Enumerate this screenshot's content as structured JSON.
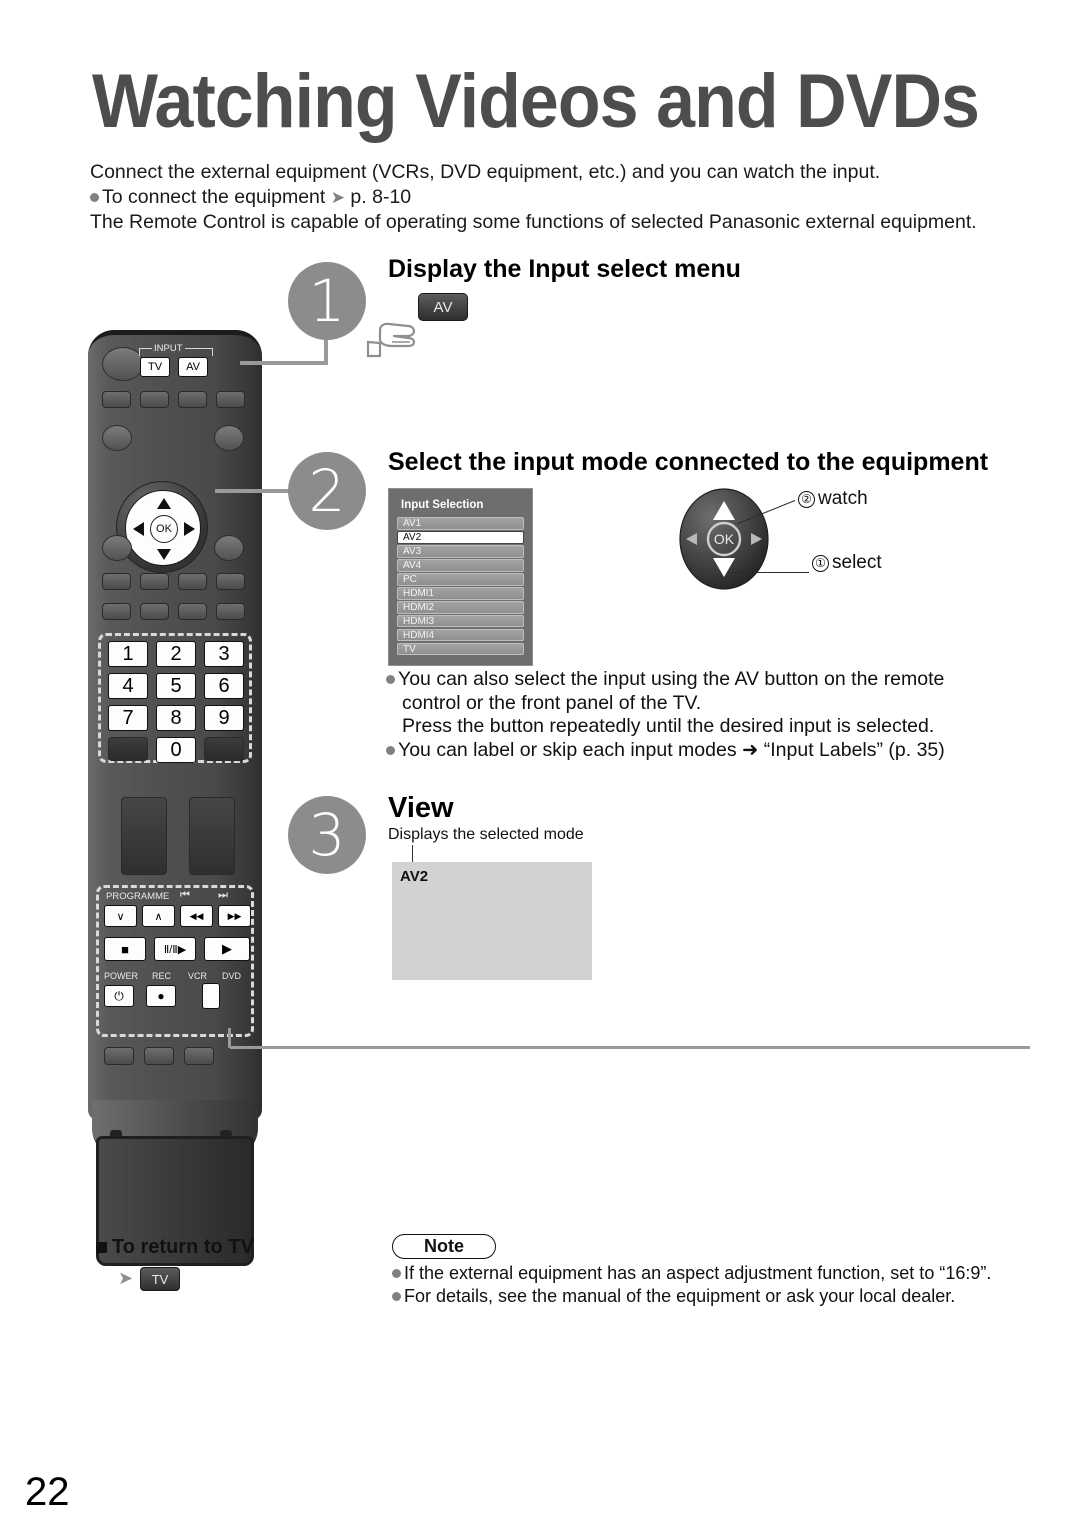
{
  "page": {
    "title": "Watching Videos and DVDs",
    "number": "22"
  },
  "intro": {
    "line1": "Connect the external equipment (VCRs, DVD equipment, etc.) and you can watch the input.",
    "bullet1": "To connect the equipment",
    "bullet1_ref": "p. 8-10",
    "line2": "The Remote Control is capable of operating some functions of selected Panasonic external equipment."
  },
  "steps": [
    {
      "number": "1",
      "heading": "Display the Input select menu",
      "button_label": "AV"
    },
    {
      "number": "2",
      "heading": "Select the input mode connected to the equipment",
      "notes": [
        "You can also select the input using the AV button on the remote",
        "control or the front panel of the TV.",
        "Press the button repeatedly until the desired input is selected.",
        "You can label or skip each input modes ➜ “Input Labels” (p. 35)"
      ]
    },
    {
      "number": "3",
      "heading": "View",
      "subtitle": "Displays the selected mode",
      "screen_label": "AV2"
    }
  ],
  "osd": {
    "title": "Input Selection",
    "items": [
      {
        "label": "AV1",
        "selected": false
      },
      {
        "label": "AV2",
        "selected": true
      },
      {
        "label": "AV3",
        "selected": false
      },
      {
        "label": "AV4",
        "selected": false
      },
      {
        "label": "PC",
        "selected": false
      },
      {
        "label": "HDMI1",
        "selected": false
      },
      {
        "label": "HDMI2",
        "selected": false
      },
      {
        "label": "HDMI3",
        "selected": false
      },
      {
        "label": "HDMI4",
        "selected": false
      },
      {
        "label": "TV",
        "selected": false
      }
    ]
  },
  "navpad": {
    "ok_label": "OK",
    "watch_num": "②",
    "watch_label": "watch",
    "select_num": "①",
    "select_label": "select"
  },
  "return_to_tv": {
    "heading": "To return to TV",
    "button_label": "TV"
  },
  "note": {
    "title": "Note",
    "lines": [
      "If the external equipment has an aspect adjustment function, set to “16:9”.",
      "For details, see the manual of the equipment or ask your local dealer."
    ]
  },
  "remote": {
    "input_group_label": "INPUT",
    "input_tv": "TV",
    "input_av": "AV",
    "ok_label": "OK",
    "numpad": [
      "1",
      "2",
      "3",
      "4",
      "5",
      "6",
      "7",
      "8",
      "9",
      "0"
    ],
    "programme_label": "PROGRAMME",
    "programme_down": "∨",
    "programme_up": "∧",
    "skip_back_icon": "⏮",
    "skip_fwd_icon": "⏭",
    "rew": "◀◀",
    "ff": "▶▶",
    "stop": "■",
    "pause_play": "Ⅱ/Ⅱ▶",
    "play": "▶",
    "power_label": "POWER",
    "rec_label": "REC",
    "vcr_label": "VCR",
    "dvd_label": "DVD",
    "power_icon": "⏻",
    "rec_icon": "●"
  },
  "colors": {
    "title_gray": "#4d4d4d",
    "step_circle": "#8c8c8c",
    "osd_bg": "#6e6e6e",
    "screen_bg": "#d2d2d2",
    "accent_dash": "#d9d9d9"
  }
}
